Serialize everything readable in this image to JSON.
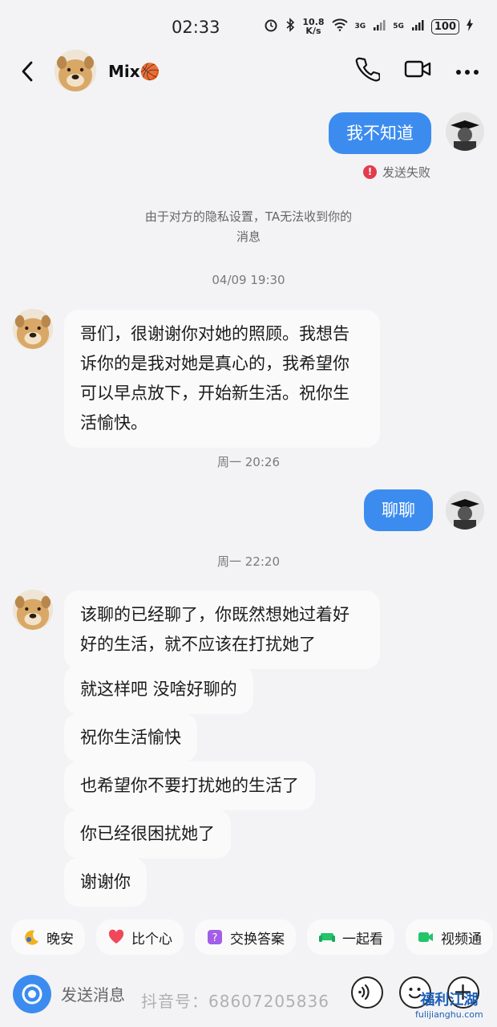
{
  "status_bar": {
    "time": "02:33",
    "net_speed_value": "10.8",
    "net_speed_unit": "K/s",
    "signal1": "3G",
    "signal2": "5G",
    "battery": "100"
  },
  "header": {
    "contact_name": "Mix🏀"
  },
  "messages": {
    "out1": "我不知道",
    "fail_status": "发送失败",
    "fail_mark": "!",
    "privacy_line1": "由于对方的隐私设置，TA无法收到你的",
    "privacy_line2": "消息",
    "ts1": "04/09 19:30",
    "in1": "哥们，很谢谢你对她的照顾。我想告诉你的是我对她是真心的，我希望你可以早点放下，开始新生活。祝你生活愉快。",
    "ts2": "周一 20:26",
    "out2": "聊聊",
    "ts3": "周一 22:20",
    "in2": "该聊的已经聊了，你既然想她过着好好的生活，就不应该在打扰她了",
    "in3": "就这样吧 没啥好聊的",
    "in4": "祝你生活愉快",
    "in5": "也希望你不要打扰她的生活了",
    "in6": "你已经很困扰她了",
    "in7": "谢谢你"
  },
  "chips": [
    {
      "label": "晚安",
      "icon": "moon-icon",
      "color": "#f2b21b"
    },
    {
      "label": "比个心",
      "icon": "heart-icon",
      "color": "#f0485a"
    },
    {
      "label": "交换答案",
      "icon": "question-icon",
      "color": "#a25ee8"
    },
    {
      "label": "一起看",
      "icon": "sofa-icon",
      "color": "#24c46a"
    },
    {
      "label": "视频通",
      "icon": "video-icon",
      "color": "#24c46a"
    }
  ],
  "input": {
    "placeholder": "发送消息"
  },
  "overlay": {
    "watermark": "抖音号：68607205836",
    "logo_cn": "福利江湖",
    "logo_en": "fulijianghu.com"
  },
  "colors": {
    "accent": "#3c8cf0",
    "background": "#f3f3f5",
    "error": "#e23c4d"
  }
}
